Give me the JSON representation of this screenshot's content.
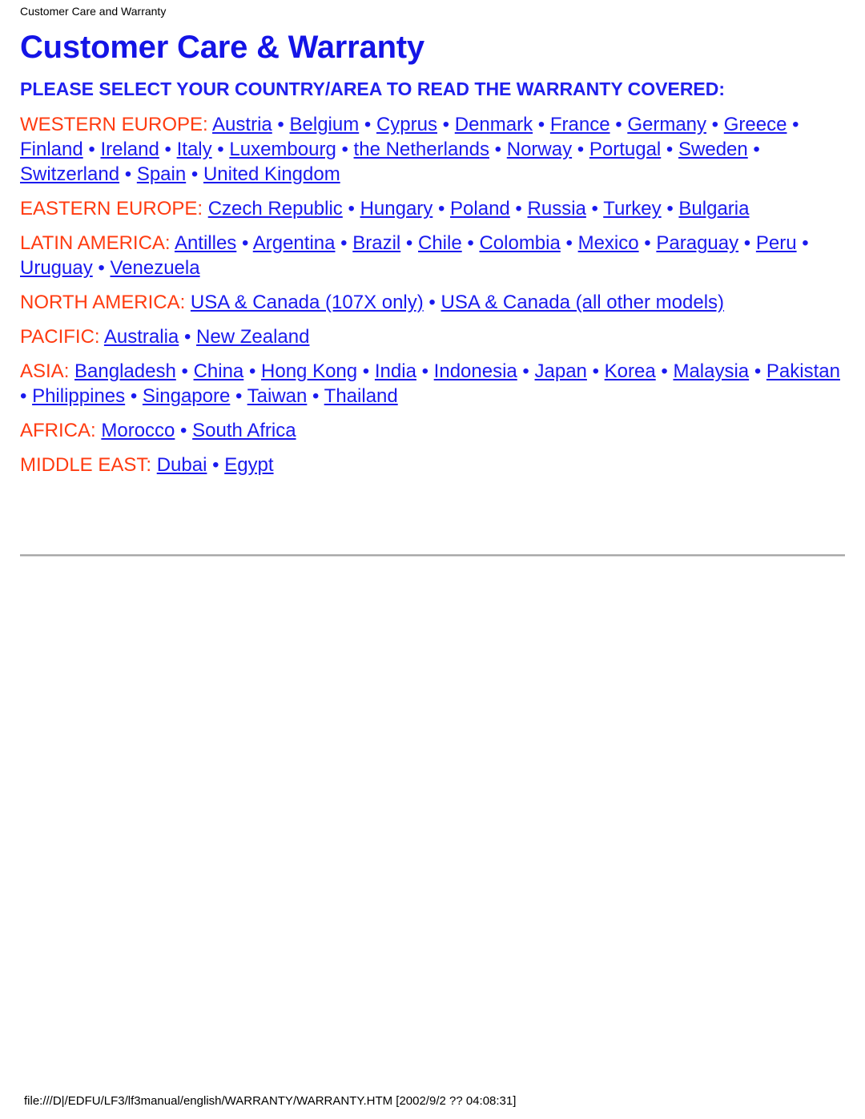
{
  "header": {
    "running_title": "Customer Care and Warranty"
  },
  "main": {
    "title": "Customer Care & Warranty",
    "prompt": "PLEASE SELECT YOUR COUNTRY/AREA TO READ THE WARRANTY COVERED:",
    "separator": "•",
    "regions": [
      {
        "label": "WESTERN EUROPE:",
        "countries": [
          "Austria",
          "Belgium",
          "Cyprus",
          "Denmark",
          "France",
          "Germany",
          "Greece",
          "Finland",
          "Ireland",
          "Italy",
          "Luxembourg",
          "the Netherlands",
          "Norway",
          "Portugal",
          "Sweden",
          "Switzerland",
          "Spain",
          "United Kingdom"
        ]
      },
      {
        "label": "EASTERN EUROPE:",
        "countries": [
          "Czech Republic",
          "Hungary",
          "Poland",
          "Russia",
          "Turkey",
          "Bulgaria"
        ]
      },
      {
        "label": "LATIN AMERICA:",
        "countries": [
          "Antilles",
          "Argentina",
          "Brazil",
          "Chile",
          "Colombia",
          "Mexico",
          "Paraguay",
          "Peru",
          "Uruguay",
          "Venezuela"
        ]
      },
      {
        "label": "NORTH AMERICA:",
        "countries": [
          "USA & Canada (107X only)",
          "USA & Canada (all other models)"
        ]
      },
      {
        "label": "PACIFIC:",
        "countries": [
          "Australia",
          "New Zealand"
        ]
      },
      {
        "label": "ASIA:",
        "countries": [
          "Bangladesh",
          "China",
          "Hong Kong",
          "India",
          "Indonesia",
          "Japan",
          "Korea",
          "Malaysia",
          "Pakistan",
          "Philippines",
          "Singapore",
          "Taiwan",
          "Thailand"
        ]
      },
      {
        "label": "AFRICA:",
        "countries": [
          "Morocco",
          "South Africa"
        ]
      },
      {
        "label": "MIDDLE EAST:",
        "countries": [
          "Dubai",
          "Egypt"
        ]
      }
    ]
  },
  "footer": {
    "path": "file:///D|/EDFU/LF3/lf3manual/english/WARRANTY/WARRANTY.HTM [2002/9/2 ?? 04:08:31]"
  },
  "colors": {
    "title_blue": "#1414E6",
    "link_blue": "#1A1AEE",
    "region_label_orange": "#FF3B10",
    "rule_gray": "#a8a8a8",
    "text_black": "#000000",
    "background": "#ffffff"
  }
}
